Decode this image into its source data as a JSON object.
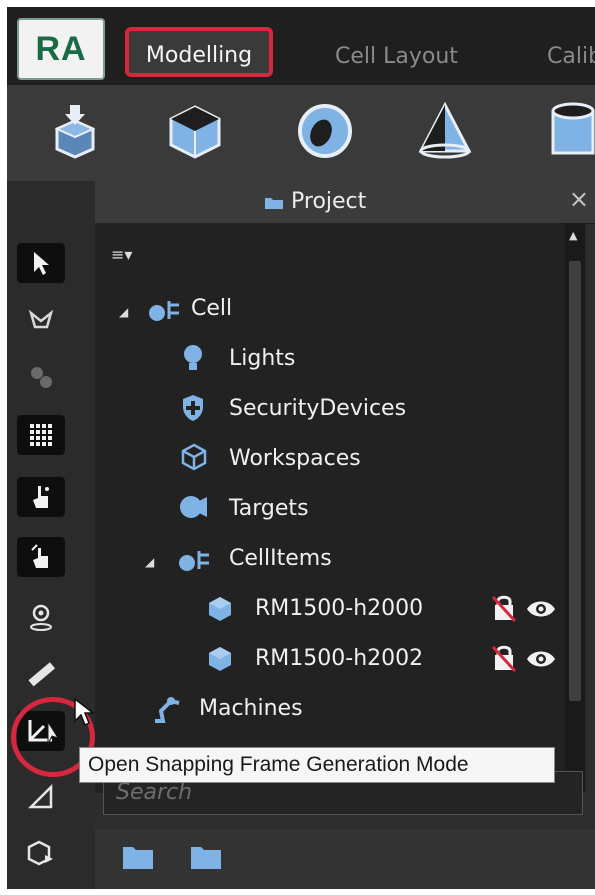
{
  "app": {
    "logo_text": "RA",
    "tabs": [
      {
        "label": "Modelling",
        "active": true
      },
      {
        "label": "Cell Layout",
        "active": false
      },
      {
        "label": "Calib",
        "active": false
      }
    ],
    "accent_color": "#d6273f",
    "icon_color": "#7fb2e5"
  },
  "ribbon": {
    "tools": [
      "import-model-icon",
      "cube-icon",
      "sphere-icon",
      "cone-icon",
      "cylinder-icon"
    ]
  },
  "left_toolbar": {
    "tools": [
      "select-pointer-icon",
      "flag-path-icon",
      "gears-icon",
      "grid-snap-icon",
      "hand-point-icon",
      "hand-drag-icon",
      "location-pin-icon",
      "ruler-icon",
      "snapping-frame-icon",
      "measure-angle-icon",
      "part-transform-icon"
    ]
  },
  "panel": {
    "title": "Project",
    "close": "×",
    "tree": [
      {
        "label": "Cell",
        "level": 0,
        "icon": "cell-group-icon",
        "expanded": true
      },
      {
        "label": "Lights",
        "level": 1,
        "icon": "lightbulb-icon"
      },
      {
        "label": "SecurityDevices",
        "level": 1,
        "icon": "shield-icon"
      },
      {
        "label": "Workspaces",
        "level": 1,
        "icon": "wire-cube-icon"
      },
      {
        "label": "Targets",
        "level": 1,
        "icon": "target-icon"
      },
      {
        "label": "CellItems",
        "level": 1,
        "icon": "cell-group-icon",
        "expanded": true
      },
      {
        "label": "RM1500-h2000",
        "level": 2,
        "icon": "robot-cube-icon",
        "badges": [
          "lock-icon",
          "eye-icon"
        ]
      },
      {
        "label": "RM1500-h2002",
        "level": 2,
        "icon": "robot-cube-icon",
        "badges": [
          "lock-icon",
          "eye-icon"
        ]
      },
      {
        "label": "Machines",
        "level": 0,
        "icon": "robot-arm-icon"
      }
    ],
    "search_placeholder": "Search"
  },
  "tooltip": {
    "text": "Open Snapping Frame Generation Mode"
  }
}
